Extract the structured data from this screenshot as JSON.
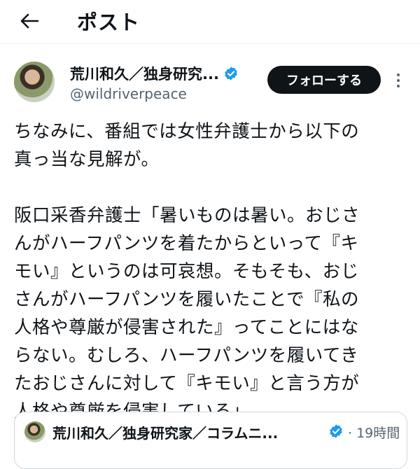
{
  "header": {
    "title": "ポスト",
    "back_icon": "arrow-left-icon"
  },
  "author": {
    "display_name": "荒川和久／独身研究...",
    "handle": "@wildriverpeace",
    "verified_icon": "verified-badge-icon",
    "follow_label": "フォローする",
    "more_icon": "more-vertical-icon"
  },
  "tweet": {
    "lines": [
      "ちなみに、番組では女性弁護士から以下の",
      "真っ当な見解が。",
      "",
      "阪口采香弁護士「暑いものは暑い。おじさ",
      "んがハーフパンツを着たからといって『キ",
      "モい』というのは可哀想。そもそも、おじ",
      "さんがハーフパンツを履いたことで『私の",
      "人格や尊厳が侵害された』ってことにはな",
      "らない。むしろ、ハーフパンツを履いてき",
      "たおじさんに対して『キモい』と言う方が",
      "人格や尊厳を侵害している」"
    ]
  },
  "quote": {
    "display_name": "荒川和久／独身研究家／コラムニ...",
    "time": "· 19時間"
  },
  "colors": {
    "text": "#0f1419",
    "secondary": "#536471",
    "verified": "#1d9bf0",
    "button_bg": "#0f1419"
  }
}
